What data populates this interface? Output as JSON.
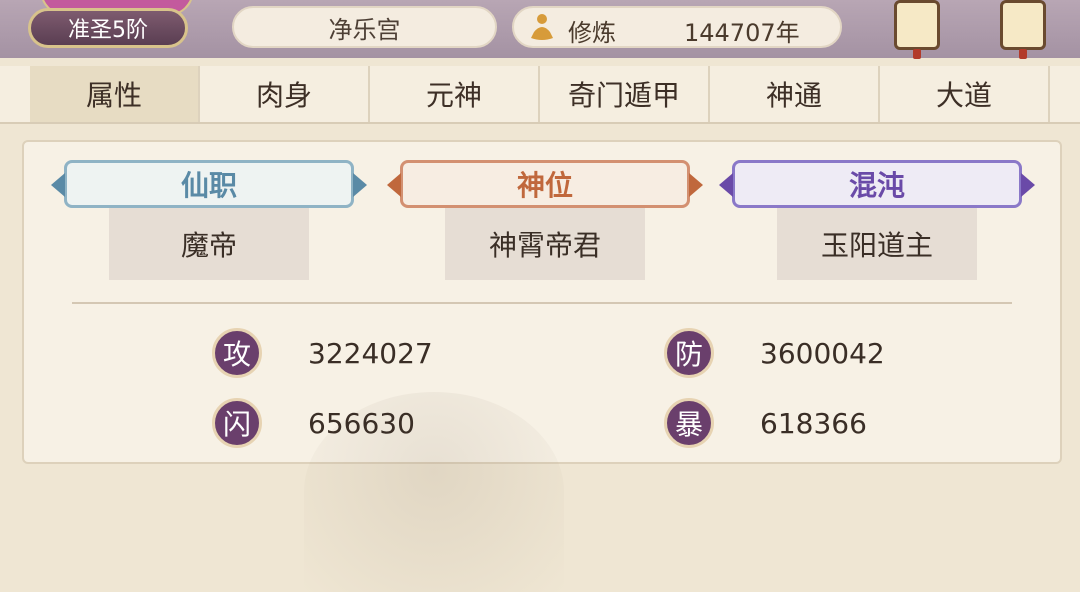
{
  "header": {
    "rank": "准圣5阶",
    "location": "净乐宫",
    "cultivation_label": "修炼",
    "cultivation_value": "144707年"
  },
  "tabs": [
    {
      "label": "属性",
      "active": true
    },
    {
      "label": "肉身"
    },
    {
      "label": "元神"
    },
    {
      "label": "奇门遁甲"
    },
    {
      "label": "神通"
    },
    {
      "label": "大道"
    }
  ],
  "titles": [
    {
      "label": "仙职",
      "value": "魔帝",
      "color": "#5a8aa6"
    },
    {
      "label": "神位",
      "value": "神霄帝君",
      "color": "#c0683c"
    },
    {
      "label": "混沌",
      "value": "玉阳道主",
      "color": "#6a4aa8"
    }
  ],
  "stats": [
    {
      "badge": "攻",
      "value": "3224027"
    },
    {
      "badge": "防",
      "value": "3600042"
    },
    {
      "badge": "闪",
      "value": "656630"
    },
    {
      "badge": "暴",
      "value": "618366"
    }
  ],
  "icons": {
    "cultivation": "meditating-figure-icon",
    "lantern": "lantern-icon"
  }
}
